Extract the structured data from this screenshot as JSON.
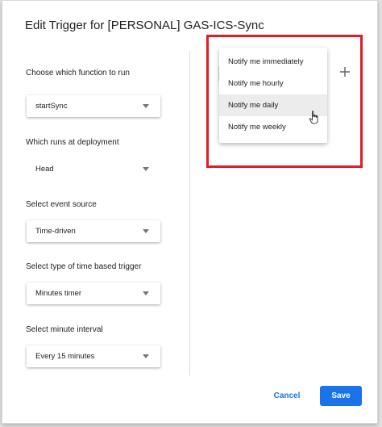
{
  "dialog": {
    "title": "Edit Trigger for [PERSONAL] GAS-ICS-Sync"
  },
  "form": {
    "function": {
      "label": "Choose which function to run",
      "value": "startSync"
    },
    "deployment": {
      "label": "Which runs at deployment",
      "value": "Head"
    },
    "event_source": {
      "label": "Select event source",
      "value": "Time-driven"
    },
    "trigger_type": {
      "label": "Select type of time based trigger",
      "value": "Minutes timer"
    },
    "interval": {
      "label": "Select minute interval",
      "value": "Every 15 minutes"
    }
  },
  "notification_menu": {
    "items": [
      {
        "label": "Notify me immediately"
      },
      {
        "label": "Notify me hourly"
      },
      {
        "label": "Notify me daily"
      },
      {
        "label": "Notify me weekly"
      }
    ],
    "hovered_index": 2
  },
  "add_icon": "plus-icon",
  "actions": {
    "cancel_label": "Cancel",
    "save_label": "Save"
  },
  "colors": {
    "accent": "#1a73e8",
    "highlight": "#e11b22",
    "menu_hover": "#ececec"
  }
}
